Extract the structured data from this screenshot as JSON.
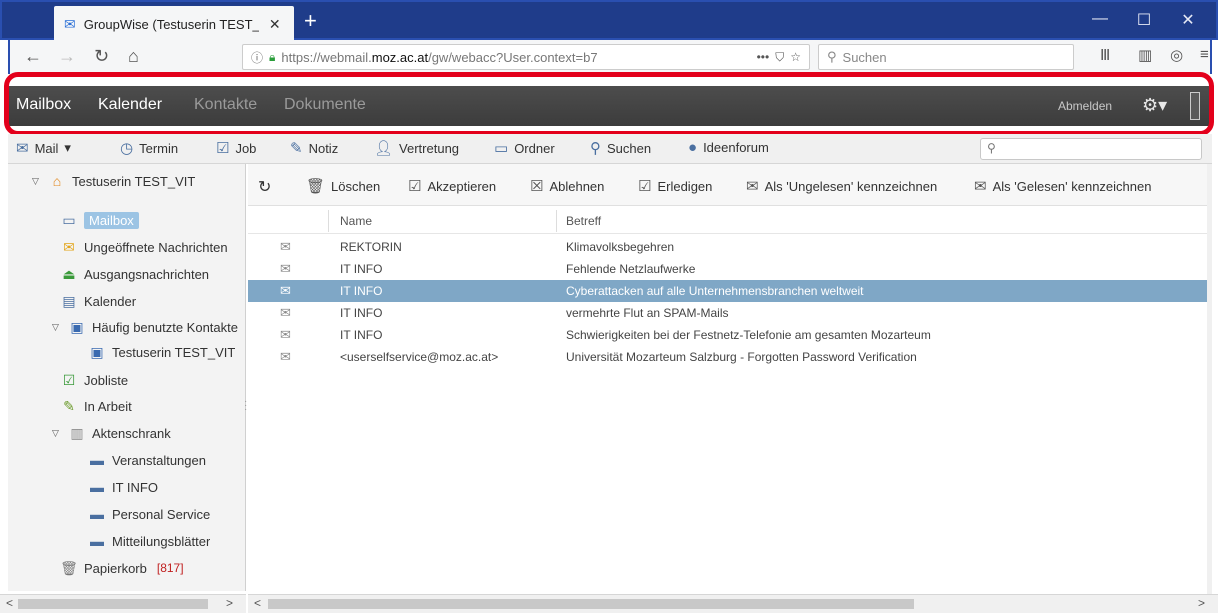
{
  "browser": {
    "tab_title": "GroupWise (Testuserin TEST_VIT",
    "tab_close": "✕",
    "new_tab": "+",
    "url_prefix": "https://webmail.",
    "url_domain": "moz.ac.at",
    "url_path": "/gw/webacc?User.context=b7",
    "url_more": "•••",
    "search_placeholder": "Suchen"
  },
  "app_nav": {
    "items": [
      "Mailbox",
      "Kalender",
      "Kontakte",
      "Dokumente"
    ],
    "logout": "Abmelden"
  },
  "actions": {
    "mail": "Mail",
    "termin": "Termin",
    "job": "Job",
    "notiz": "Notiz",
    "vertretung": "Vertretung",
    "ordner": "Ordner",
    "suchen": "Suchen",
    "ideenforum": "Ideenforum"
  },
  "sidebar": {
    "user": "Testuserin TEST_VIT",
    "items": [
      "Mailbox",
      "Ungeöffnete Nachrichten",
      "Ausgangsnachrichten",
      "Kalender",
      "Häufig benutzte Kontakte",
      "Testuserin TEST_VIT",
      "Jobliste",
      "In Arbeit",
      "Aktenschrank",
      "Veranstaltungen",
      "IT INFO",
      "Personal Service",
      "Mitteilungsblätter",
      "Papierkorb"
    ],
    "trash_count": "[817]"
  },
  "message_toolbar": {
    "delete": "Löschen",
    "accept": "Akzeptieren",
    "decline": "Ablehnen",
    "complete": "Erledigen",
    "mark_unread": "Als 'Ungelesen' kennzeichnen",
    "mark_read": "Als 'Gelesen' kennzeichnen"
  },
  "columns": {
    "name": "Name",
    "subject": "Betreff"
  },
  "messages": [
    {
      "from": "REKTORIN",
      "subject": "Klimavolksbegehren"
    },
    {
      "from": "IT INFO",
      "subject": "Fehlende Netzlaufwerke"
    },
    {
      "from": "IT INFO",
      "subject": "Cyberattacken auf alle Unternehmensbranchen weltweit"
    },
    {
      "from": "IT INFO",
      "subject": "vermehrte Flut an SPAM-Mails"
    },
    {
      "from": "IT INFO",
      "subject": "Schwierigkeiten bei der Festnetz-Telefonie am gesamten Mozarteum"
    },
    {
      "from": "<userselfservice@moz.ac.at>",
      "subject": "Universität Mozarteum Salzburg - Forgotten Password Verification"
    }
  ],
  "colors": {
    "accent_red": "#e3001b",
    "titlebar_blue": "#1f3c8a",
    "selection_blue": "#7fa7c6"
  }
}
